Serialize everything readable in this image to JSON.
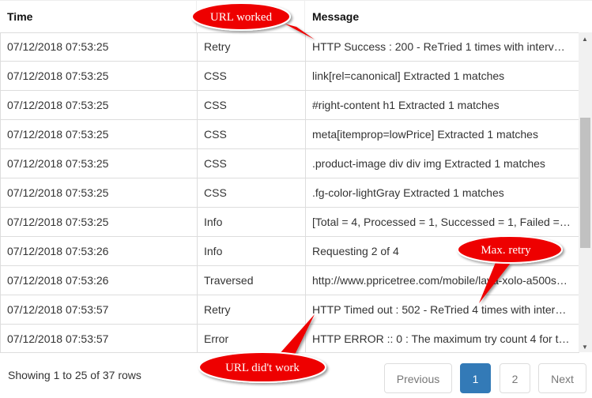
{
  "table": {
    "headers": [
      "Time",
      "",
      "Message"
    ],
    "rows": [
      [
        "07/12/2018 07:53:25",
        "Retry",
        "HTTP Success : 200 - ReTried 1 times with interv…"
      ],
      [
        "07/12/2018 07:53:25",
        "CSS",
        "link[rel=canonical] Extracted 1 matches"
      ],
      [
        "07/12/2018 07:53:25",
        "CSS",
        "#right-content h1 Extracted 1 matches"
      ],
      [
        "07/12/2018 07:53:25",
        "CSS",
        "meta[itemprop=lowPrice] Extracted 1 matches"
      ],
      [
        "07/12/2018 07:53:25",
        "CSS",
        ".product-image div div img Extracted 1 matches"
      ],
      [
        "07/12/2018 07:53:25",
        "CSS",
        ".fg-color-lightGray Extracted 1 matches"
      ],
      [
        "07/12/2018 07:53:25",
        "Info",
        "[Total = 4, Processed = 1, Successed = 1, Failed =…"
      ],
      [
        "07/12/2018 07:53:26",
        "Info",
        "Requesting 2 of 4"
      ],
      [
        "07/12/2018 07:53:26",
        "Traversed",
        "http://www.ppricetree.com/mobile/lava-xolo-a500s…"
      ],
      [
        "07/12/2018 07:53:57",
        "Retry",
        "HTTP Timed out : 502 - ReTried 4 times with inter…"
      ],
      [
        "07/12/2018 07:53:57",
        "Error",
        "HTTP ERROR :: 0 : The maximum try count 4 for t…"
      ]
    ]
  },
  "footer": {
    "summary": "Showing 1 to 25 of 37 rows",
    "previous": "Previous",
    "page1": "1",
    "page2": "2",
    "next": "Next"
  },
  "callouts": {
    "worked": "URL worked",
    "max_retry": "Max. retry",
    "didnt_work": "URL did't work"
  },
  "colors": {
    "callout": "#ee0000",
    "active_page": "#337ab7"
  }
}
